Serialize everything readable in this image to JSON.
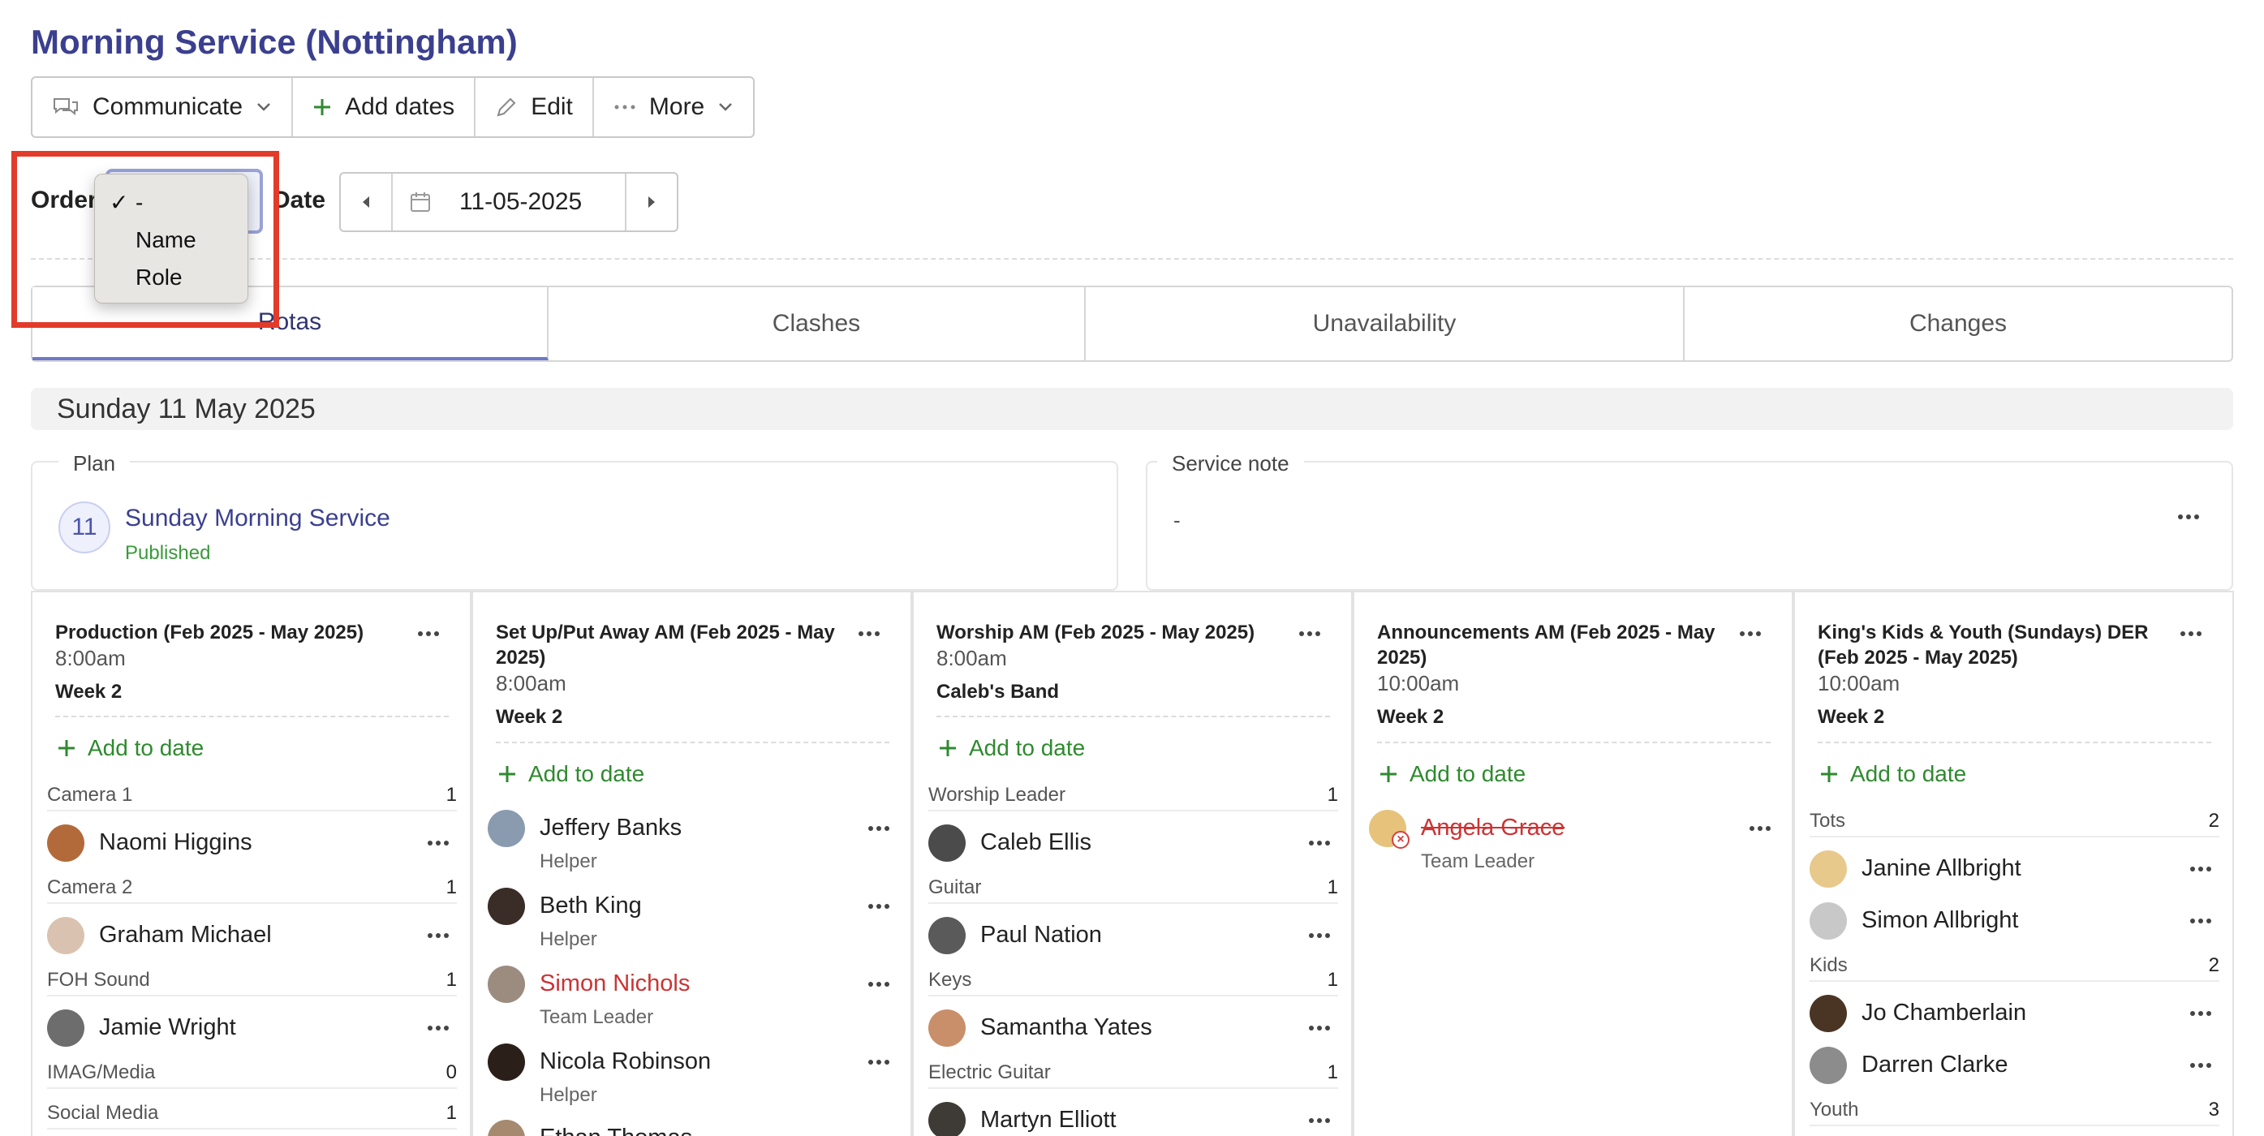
{
  "page": {
    "title": "Morning Service (Nottingham)"
  },
  "toolbar": {
    "communicate": "Communicate",
    "add_dates": "Add dates",
    "edit": "Edit",
    "more": "More"
  },
  "filters": {
    "order_label": "Order",
    "date_label": "Date",
    "date_value": "11-05-2025"
  },
  "order_dropdown": {
    "options": [
      "-",
      "Name",
      "Role"
    ],
    "selected": "-"
  },
  "tabs": [
    "Rotas",
    "Clashes",
    "Unavailability",
    "Changes"
  ],
  "day_header": "Sunday 11 May 2025",
  "plan": {
    "legend": "Plan",
    "day": "11",
    "name": "Sunday Morning Service",
    "status": "Published"
  },
  "service_note": {
    "legend": "Service note",
    "text": "-"
  },
  "add_to_date": "Add to date",
  "columns": [
    {
      "title": "Production (Feb 2025 - May 2025)",
      "time": "8:00am",
      "sub": "Week 2",
      "roles": [
        {
          "role": "Camera 1",
          "count": "1",
          "people": [
            {
              "name": "Naomi Higgins"
            }
          ]
        },
        {
          "role": "Camera 2",
          "count": "1",
          "people": [
            {
              "name": "Graham Michael"
            }
          ]
        },
        {
          "role": "FOH Sound",
          "count": "1",
          "people": [
            {
              "name": "Jamie Wright"
            }
          ]
        },
        {
          "role": "IMAG/Media",
          "count": "0",
          "people": []
        },
        {
          "role": "Social Media",
          "count": "1",
          "people": []
        }
      ]
    },
    {
      "title": "Set Up/Put Away AM (Feb 2025 - May 2025)",
      "time": "8:00am",
      "sub": "Week 2",
      "people": [
        {
          "name": "Jeffery Banks",
          "role": "Helper"
        },
        {
          "name": "Beth King",
          "role": "Helper"
        },
        {
          "name": "Simon Nichols",
          "role": "Team Leader"
        },
        {
          "name": "Nicola Robinson",
          "role": "Helper"
        },
        {
          "name": "Ethan Thomas"
        }
      ]
    },
    {
      "title": "Worship AM (Feb 2025 - May 2025)",
      "time": "8:00am",
      "sub": "Caleb's Band",
      "roles": [
        {
          "role": "Worship Leader",
          "count": "1",
          "people": [
            {
              "name": "Caleb Ellis"
            }
          ]
        },
        {
          "role": "Guitar",
          "count": "1",
          "people": [
            {
              "name": "Paul Nation"
            }
          ]
        },
        {
          "role": "Keys",
          "count": "1",
          "people": [
            {
              "name": "Samantha Yates"
            }
          ]
        },
        {
          "role": "Electric Guitar",
          "count": "1",
          "people": [
            {
              "name": "Martyn Elliott"
            }
          ]
        }
      ]
    },
    {
      "title": "Announcements AM (Feb 2025 - May 2025)",
      "time": "10:00am",
      "sub": "Week 2",
      "people": [
        {
          "name": "Angela Grace",
          "role": "Team Leader"
        }
      ]
    },
    {
      "title": "King's Kids & Youth (Sundays) DER (Feb 2025 - May 2025)",
      "time": "10:00am",
      "sub": "Week 2",
      "roles": [
        {
          "role": "Tots",
          "count": "2",
          "people": [
            {
              "name": "Janine Allbright"
            },
            {
              "name": "Simon Allbright"
            }
          ]
        },
        {
          "role": "Kids",
          "count": "2",
          "people": [
            {
              "name": "Jo Chamberlain"
            },
            {
              "name": "Darren Clarke"
            }
          ]
        },
        {
          "role": "Youth",
          "count": "3",
          "people": []
        }
      ]
    }
  ],
  "colors": {
    "title": "#3b3f8f",
    "add_green": "#2f8a2f",
    "declined_red": "#cc3333",
    "highlight": "#e23b2a"
  }
}
